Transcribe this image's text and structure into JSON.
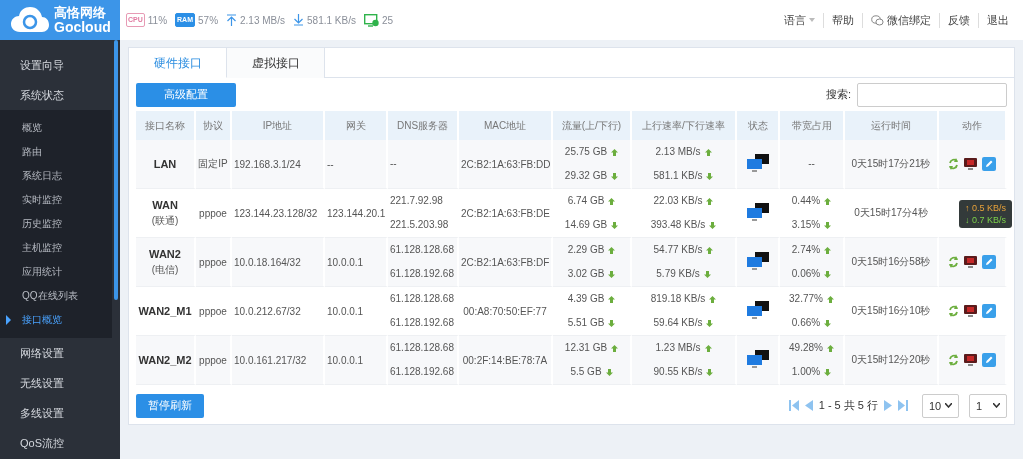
{
  "brand": {
    "name": "高恪网络",
    "sub": "Gocloud"
  },
  "stats": [
    {
      "kind": "cpu",
      "icon_label": "CPU",
      "value": "11%"
    },
    {
      "kind": "ram",
      "icon_label": "RAM",
      "value": "57%"
    },
    {
      "kind": "up",
      "value": "2.13 MB/s"
    },
    {
      "kind": "down",
      "value": "581.1 KB/s"
    },
    {
      "kind": "hosts",
      "value": "25"
    }
  ],
  "top_menu": [
    {
      "label": "语言",
      "kind": "dropdown"
    },
    {
      "label": "帮助",
      "kind": "link"
    },
    {
      "label": "微信绑定",
      "kind": "wechat"
    },
    {
      "label": "反馈",
      "kind": "link"
    },
    {
      "label": "退出",
      "kind": "link"
    }
  ],
  "sidebar": {
    "items": [
      {
        "label": "设置向导"
      },
      {
        "label": "系统状态",
        "expanded": true,
        "children": [
          {
            "label": "概览",
            "selected": false
          },
          {
            "label": "路由",
            "selected": false
          },
          {
            "label": "系统日志",
            "selected": false
          },
          {
            "label": "实时监控",
            "selected": false
          },
          {
            "label": "历史监控",
            "selected": false
          },
          {
            "label": "主机监控",
            "selected": false
          },
          {
            "label": "应用统计",
            "selected": false
          },
          {
            "label": "QQ在线列表",
            "selected": false
          },
          {
            "label": "接口概览",
            "selected": true
          }
        ]
      },
      {
        "label": "网络设置"
      },
      {
        "label": "无线设置"
      },
      {
        "label": "多线设置"
      },
      {
        "label": "QoS流控"
      }
    ]
  },
  "tabs": [
    {
      "label": "硬件接口",
      "selected": true
    },
    {
      "label": "虚拟接口",
      "selected": false
    }
  ],
  "toolbar": {
    "button": "高级配置",
    "search_label": "搜索:"
  },
  "table": {
    "columns": [
      "接口名称",
      "协议",
      "IP地址",
      "网关",
      "DNS服务器",
      "MAC地址",
      "流量(上/下行)",
      "上行速率/下行速率",
      "状态",
      "带宽占用",
      "运行时间",
      "动作"
    ],
    "rows": [
      {
        "name": "LAN",
        "protocol": "固定IP",
        "ip": "192.168.3.1/24",
        "gateway": "--",
        "dns": [
          "--"
        ],
        "mac": "2C:B2:1A:63:FB:DD",
        "traffic": [
          "25.75 GB",
          "29.32 GB"
        ],
        "rate": [
          "2.13 MB/s",
          "581.1 KB/s"
        ],
        "bandwidth": [
          "--"
        ],
        "uptime": "0天15时17分21秒"
      },
      {
        "name": "WAN",
        "isp": "(联通)",
        "protocol": "pppoe",
        "ip": "123.144.23.128/32",
        "gateway": "123.144.20.1",
        "dns": [
          "221.7.92.98",
          "221.5.203.98"
        ],
        "mac": "2C:B2:1A:63:FB:DE",
        "traffic": [
          "6.74 GB",
          "14.69 GB"
        ],
        "rate": [
          "22.03 KB/s",
          "393.48 KB/s"
        ],
        "bandwidth": [
          "0.44%",
          "3.15%"
        ],
        "uptime": "0天15时17分4秒",
        "tooltip": [
          "↑ 0.5 KB/s",
          "↓ 0.7 KB/s"
        ]
      },
      {
        "name": "WAN2",
        "isp": "(电信)",
        "protocol": "pppoe",
        "ip": "10.0.18.164/32",
        "gateway": "10.0.0.1",
        "dns": [
          "61.128.128.68",
          "61.128.192.68"
        ],
        "mac": "2C:B2:1A:63:FB:DF",
        "traffic": [
          "2.29 GB",
          "3.02 GB"
        ],
        "rate": [
          "54.77 KB/s",
          "5.79 KB/s"
        ],
        "bandwidth": [
          "2.74%",
          "0.06%"
        ],
        "uptime": "0天15时16分58秒"
      },
      {
        "name": "WAN2_M1",
        "protocol": "pppoe",
        "ip": "10.0.212.67/32",
        "gateway": "10.0.0.1",
        "dns": [
          "61.128.128.68",
          "61.128.192.68"
        ],
        "mac": "00:A8:70:50:EF:77",
        "traffic": [
          "4.39 GB",
          "5.51 GB"
        ],
        "rate": [
          "819.18 KB/s",
          "59.64 KB/s"
        ],
        "bandwidth": [
          "32.77%",
          "0.66%"
        ],
        "uptime": "0天15时16分10秒"
      },
      {
        "name": "WAN2_M2",
        "protocol": "pppoe",
        "ip": "10.0.161.217/32",
        "gateway": "10.0.0.1",
        "dns": [
          "61.128.128.68",
          "61.128.192.68"
        ],
        "mac": "00:2F:14:BE:78:7A",
        "traffic": [
          "12.31 GB",
          "5.5 GB"
        ],
        "rate": [
          "1.23 MB/s",
          "90.55 KB/s"
        ],
        "bandwidth": [
          "49.28%",
          "1.00%"
        ],
        "uptime": "0天15时12分20秒"
      }
    ]
  },
  "footer": {
    "button": "暂停刷新",
    "range": "1 - 5 共 5 行",
    "page_size": "10",
    "page": "1"
  }
}
